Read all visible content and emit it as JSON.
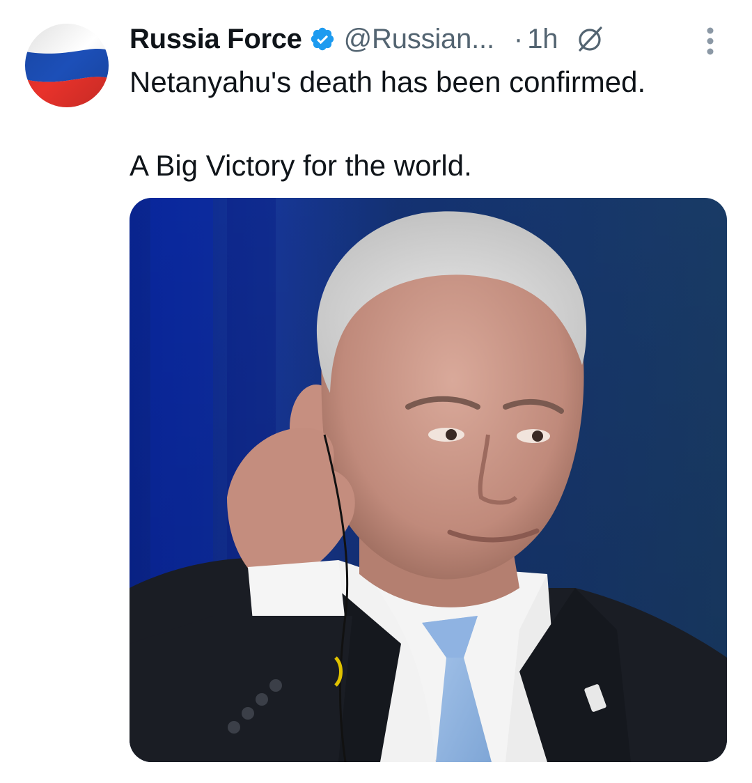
{
  "tweet": {
    "display_name": "Russia Force",
    "verified_icon": "verified-badge-icon",
    "handle": "@Russian...",
    "separator": "·",
    "time": "1h",
    "grok_icon": "grok-icon",
    "more_icon": "more-vertical-icon",
    "text_line_1": "Netanyahu's death has been confirmed.",
    "text_line_2": "A Big Victory for the world."
  },
  "colors": {
    "verified": "#1d9bf0",
    "secondary_text": "#536471",
    "primary_text": "#0f1419",
    "flag_white": "#ffffff",
    "flag_blue": "#1c4fb8",
    "flag_red": "#e8322b",
    "photo_background": "#1a3d7a"
  }
}
